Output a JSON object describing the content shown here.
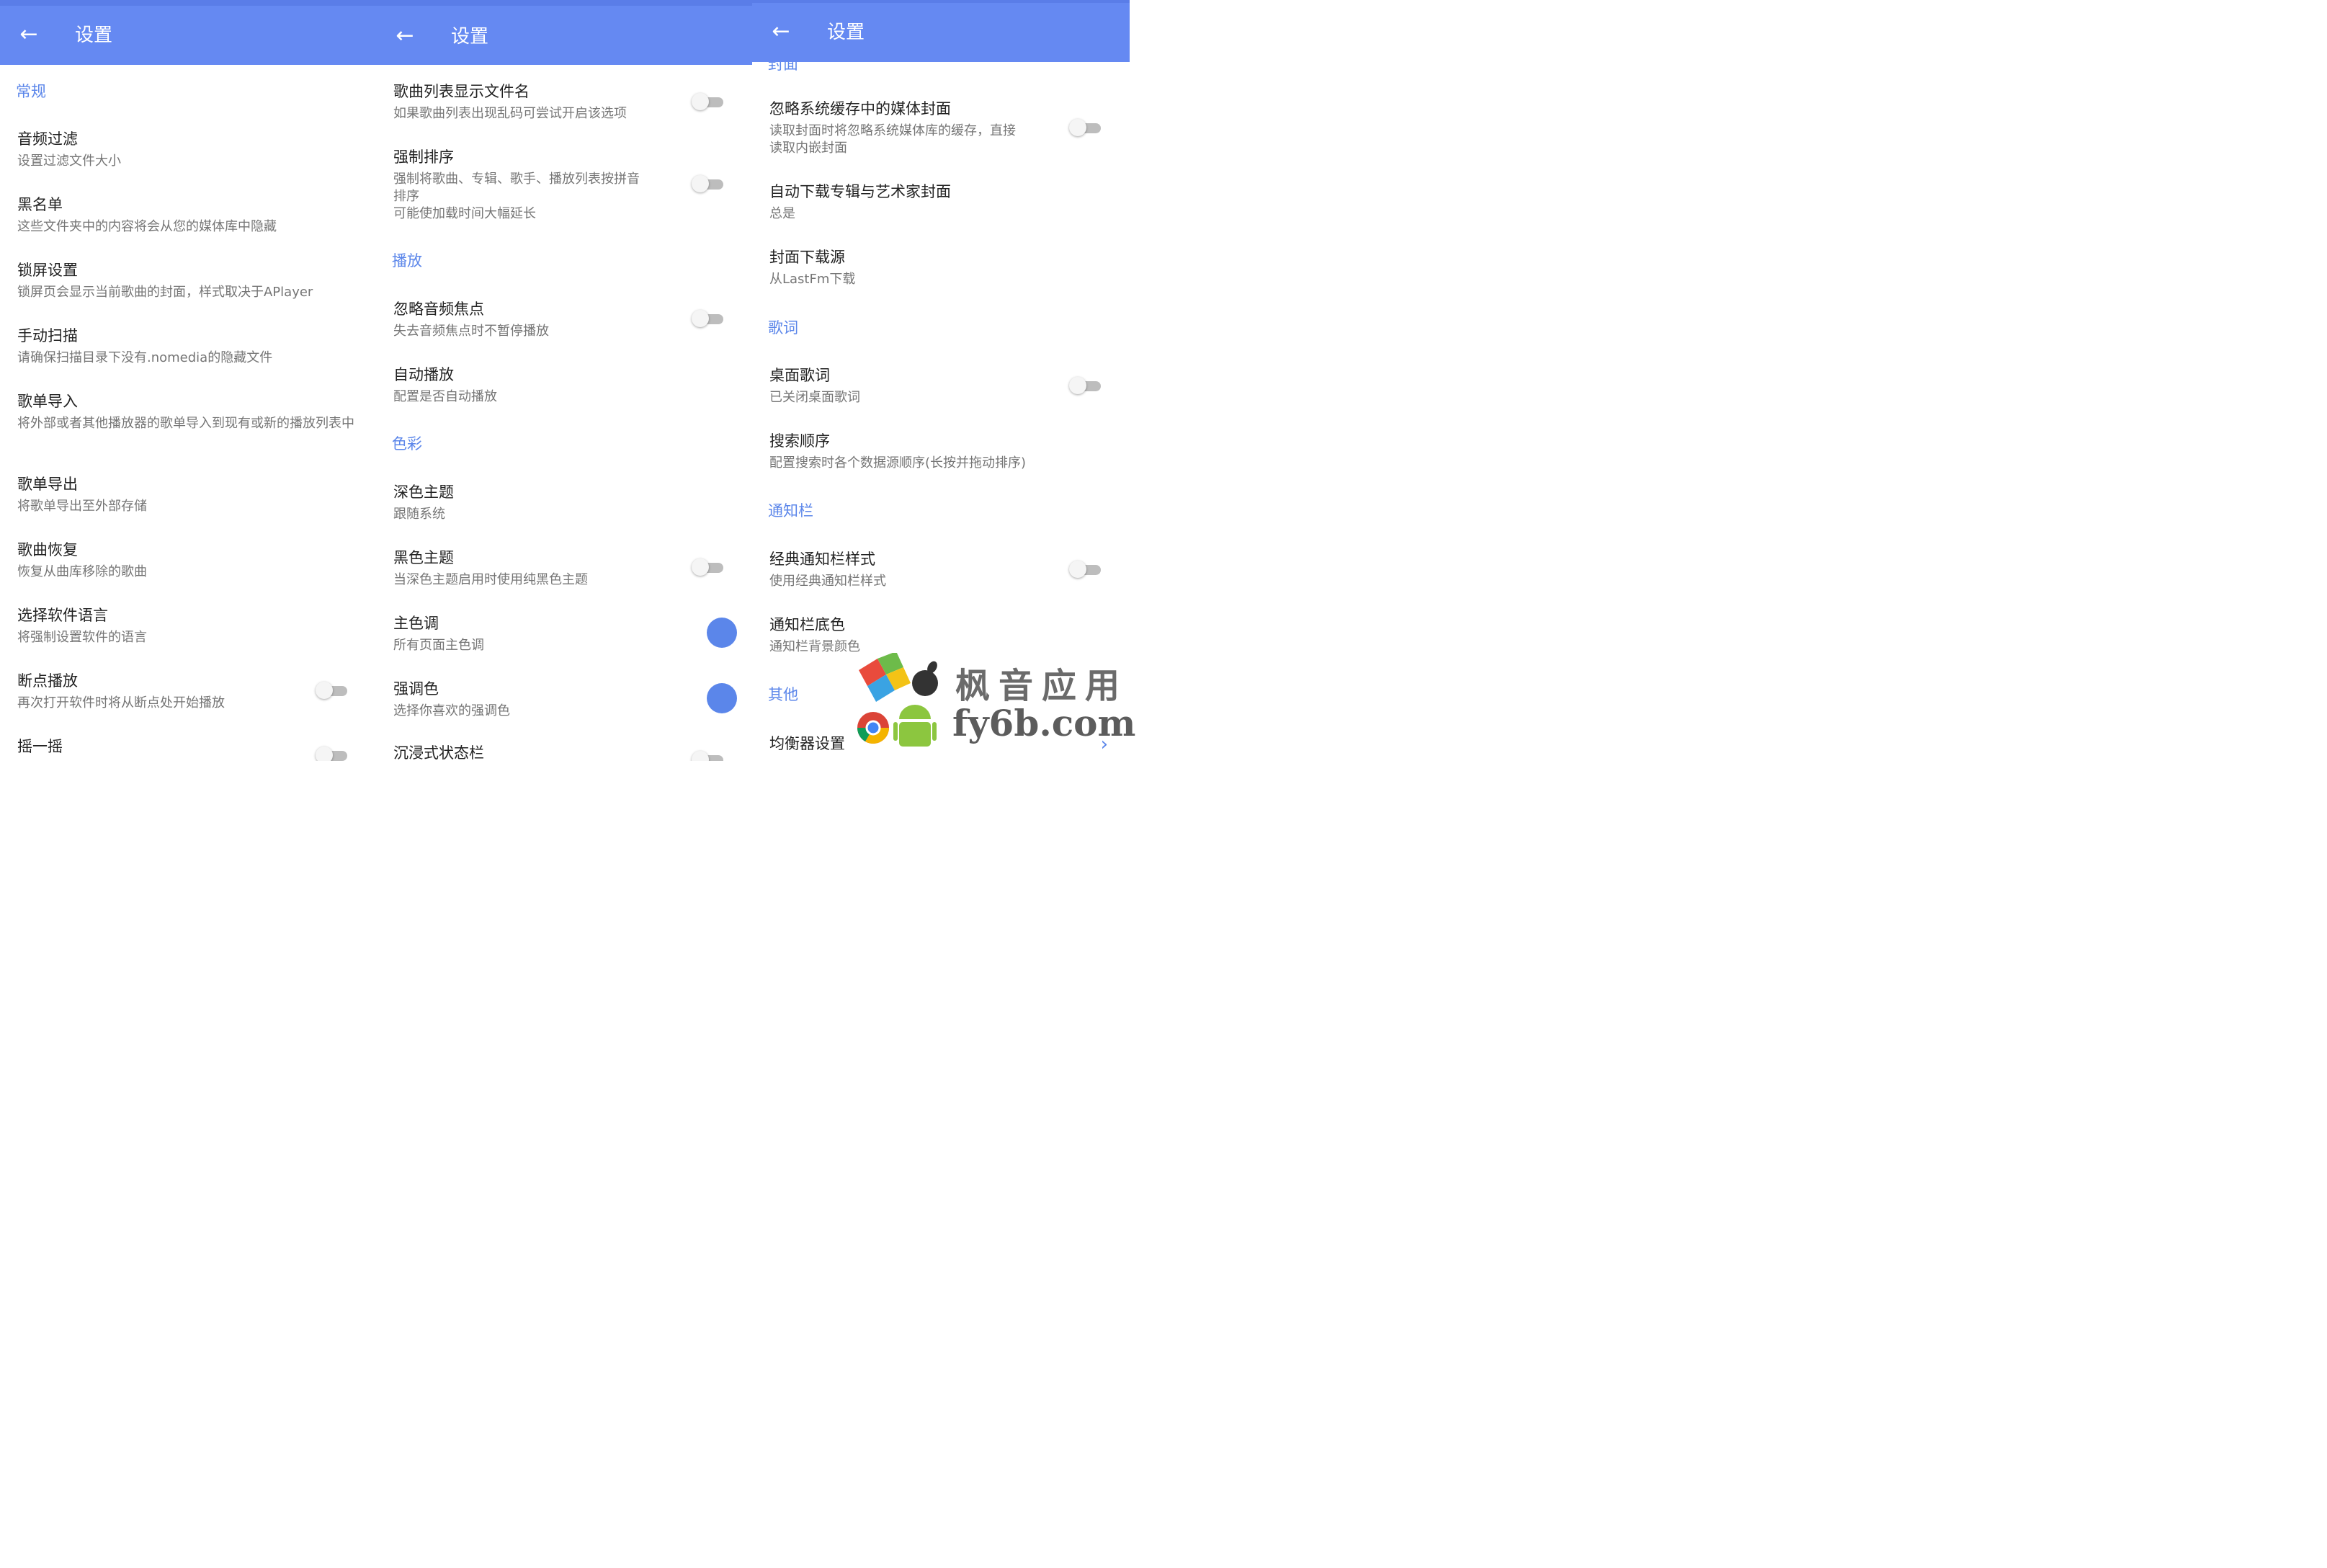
{
  "panel1": {
    "title": "设置",
    "sections": {
      "general": "常规"
    },
    "items": [
      {
        "title": "音频过滤",
        "subtitle": "设置过滤文件大小"
      },
      {
        "title": "黑名单",
        "subtitle": "这些文件夹中的内容将会从您的媒体库中隐藏"
      },
      {
        "title": "锁屏设置",
        "subtitle": "锁屏页会显示当前歌曲的封面，样式取决于APlayer"
      },
      {
        "title": "手动扫描",
        "subtitle": "请确保扫描目录下没有.nomedia的隐藏文件"
      },
      {
        "title": "歌单导入",
        "subtitle": "将外部或者其他播放器的歌单导入到现有或新的播放列表中"
      },
      {
        "title": "歌单导出",
        "subtitle": "将歌单导出至外部存储"
      },
      {
        "title": "歌曲恢复",
        "subtitle": "恢复从曲库移除的歌曲"
      },
      {
        "title": "选择软件语言",
        "subtitle": "将强制设置软件的语言"
      },
      {
        "title": "断点播放",
        "subtitle": "再次打开软件时将从断点处开始播放",
        "switch_on": false
      },
      {
        "title": "摇一摇",
        "subtitle": "",
        "switch_on": false
      }
    ]
  },
  "panel2": {
    "title": "设置",
    "sections": {
      "playback": "播放",
      "color": "色彩"
    },
    "items": [
      {
        "title": "歌曲列表显示文件名",
        "subtitle": "如果歌曲列表出现乱码可尝试开启该选项",
        "switch_on": false
      },
      {
        "title": "强制排序",
        "subtitle_line1": "强制将歌曲、专辑、歌手、播放列表按拼音",
        "subtitle_line2": "排序",
        "subtitle_line3": "可能使加载时间大幅延长",
        "switch_on": false
      },
      {
        "title": "忽略音频焦点",
        "subtitle": "失去音频焦点时不暂停播放",
        "switch_on": false
      },
      {
        "title": "自动播放",
        "subtitle": "配置是否自动播放"
      },
      {
        "title": "深色主题",
        "subtitle": "跟随系统"
      },
      {
        "title": "黑色主题",
        "subtitle": "当深色主题启用时使用纯黑色主题",
        "switch_on": false
      },
      {
        "title": "主色调",
        "subtitle": "所有页面主色调",
        "color": "#5b86ea"
      },
      {
        "title": "强调色",
        "subtitle": "选择你喜欢的强调色",
        "color": "#5b86ea"
      },
      {
        "title": "沉浸式状态栏",
        "subtitle": "",
        "switch_on": false
      }
    ]
  },
  "panel3": {
    "title": "设置",
    "sections": {
      "cover_partial": "封面",
      "lyrics": "歌词",
      "notification": "通知栏",
      "other": "其他"
    },
    "items": [
      {
        "title": "忽略系统缓存中的媒体封面",
        "subtitle_line1": "读取封面时将忽略系统媒体库的缓存，直接",
        "subtitle_line2": "读取内嵌封面",
        "switch_on": false
      },
      {
        "title": "自动下载专辑与艺术家封面",
        "subtitle": "总是"
      },
      {
        "title": "封面下载源",
        "subtitle": "从LastFm下载"
      },
      {
        "title": "桌面歌词",
        "subtitle": "已关闭桌面歌词",
        "switch_on": false
      },
      {
        "title": "搜索顺序",
        "subtitle": "配置搜索时各个数据源顺序(长按并拖动排序)"
      },
      {
        "title": "经典通知栏样式",
        "subtitle": "使用经典通知栏样式",
        "switch_on": false
      },
      {
        "title": "通知栏底色",
        "subtitle": "通知栏背景颜色"
      },
      {
        "title": "均衡器设置",
        "subtitle": ""
      }
    ]
  },
  "watermark": {
    "line1": "枫音应用",
    "line2": "fy6b.com"
  },
  "colors": {
    "appbar": "#6589f2",
    "accent": "#5b86ea"
  },
  "icons": {
    "back": "arrow-left-icon",
    "chevron": "chevron-right-icon"
  }
}
